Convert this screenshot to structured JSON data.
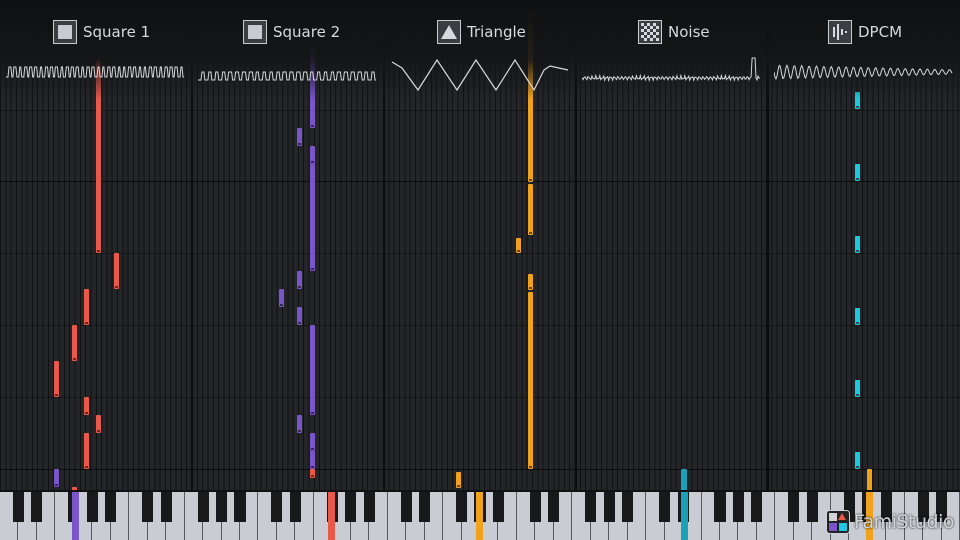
{
  "channels": [
    {
      "label": "Square 1",
      "icon": "square-wave-icon",
      "color": "#e8594a"
    },
    {
      "label": "Square 2",
      "icon": "square-wave-icon",
      "color": "#7a55c9"
    },
    {
      "label": "Triangle",
      "icon": "triangle-wave-icon",
      "color": "#f0a21c"
    },
    {
      "label": "Noise",
      "icon": "noise-icon",
      "color": "#1aa0b8"
    },
    {
      "label": "DPCM",
      "icon": "dpcm-icon",
      "color": "#1ec8e0"
    }
  ],
  "branding": {
    "app_name": "FamiStudio"
  }
}
